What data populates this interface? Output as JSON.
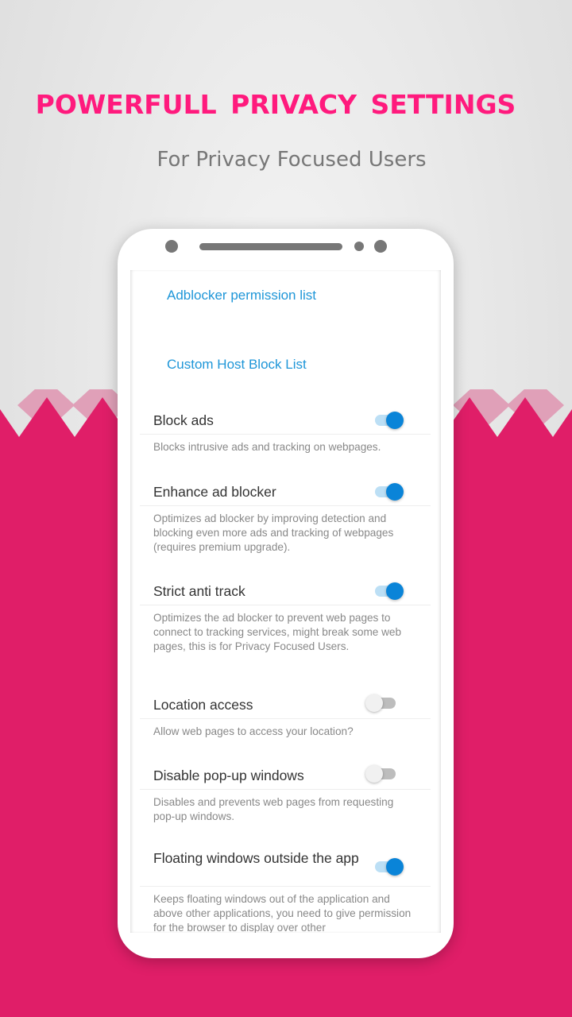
{
  "promo": {
    "headline": "POWERFULL  PRIVACY SETTINGS",
    "subheadline": "For Privacy Focused Users"
  },
  "colors": {
    "headline": "#ff1a7d",
    "band": "#e91e63",
    "band_light": "#e0a0b8",
    "link": "#1e96d8",
    "toggle_on": "#0a84d8"
  },
  "screen": {
    "links": [
      {
        "label": "Adblocker permission list"
      },
      {
        "label": "Custom Host Block List"
      }
    ],
    "settings": [
      {
        "title": "Block ads",
        "description": "Blocks intrusive ads and tracking on webpages.",
        "enabled": true
      },
      {
        "title": "Enhance ad blocker",
        "description": "Optimizes ad blocker by improving detection and blocking even more ads and tracking of webpages (requires premium upgrade).",
        "enabled": true
      },
      {
        "title": "Strict anti track",
        "description": "Optimizes the ad blocker to prevent web pages to connect to tracking services, might break some web pages, this is for Privacy Focused Users.",
        "enabled": true
      },
      {
        "title": "Location access",
        "description": "Allow web pages to access your location?",
        "enabled": false
      },
      {
        "title": "Disable pop-up windows",
        "description": "Disables and prevents web pages from requesting pop-up windows.",
        "enabled": false
      },
      {
        "title": "Floating windows outside the app",
        "description": "Keeps floating windows out of the application and above other applications, you need to give permission for the browser to display over other",
        "enabled": true
      }
    ]
  }
}
